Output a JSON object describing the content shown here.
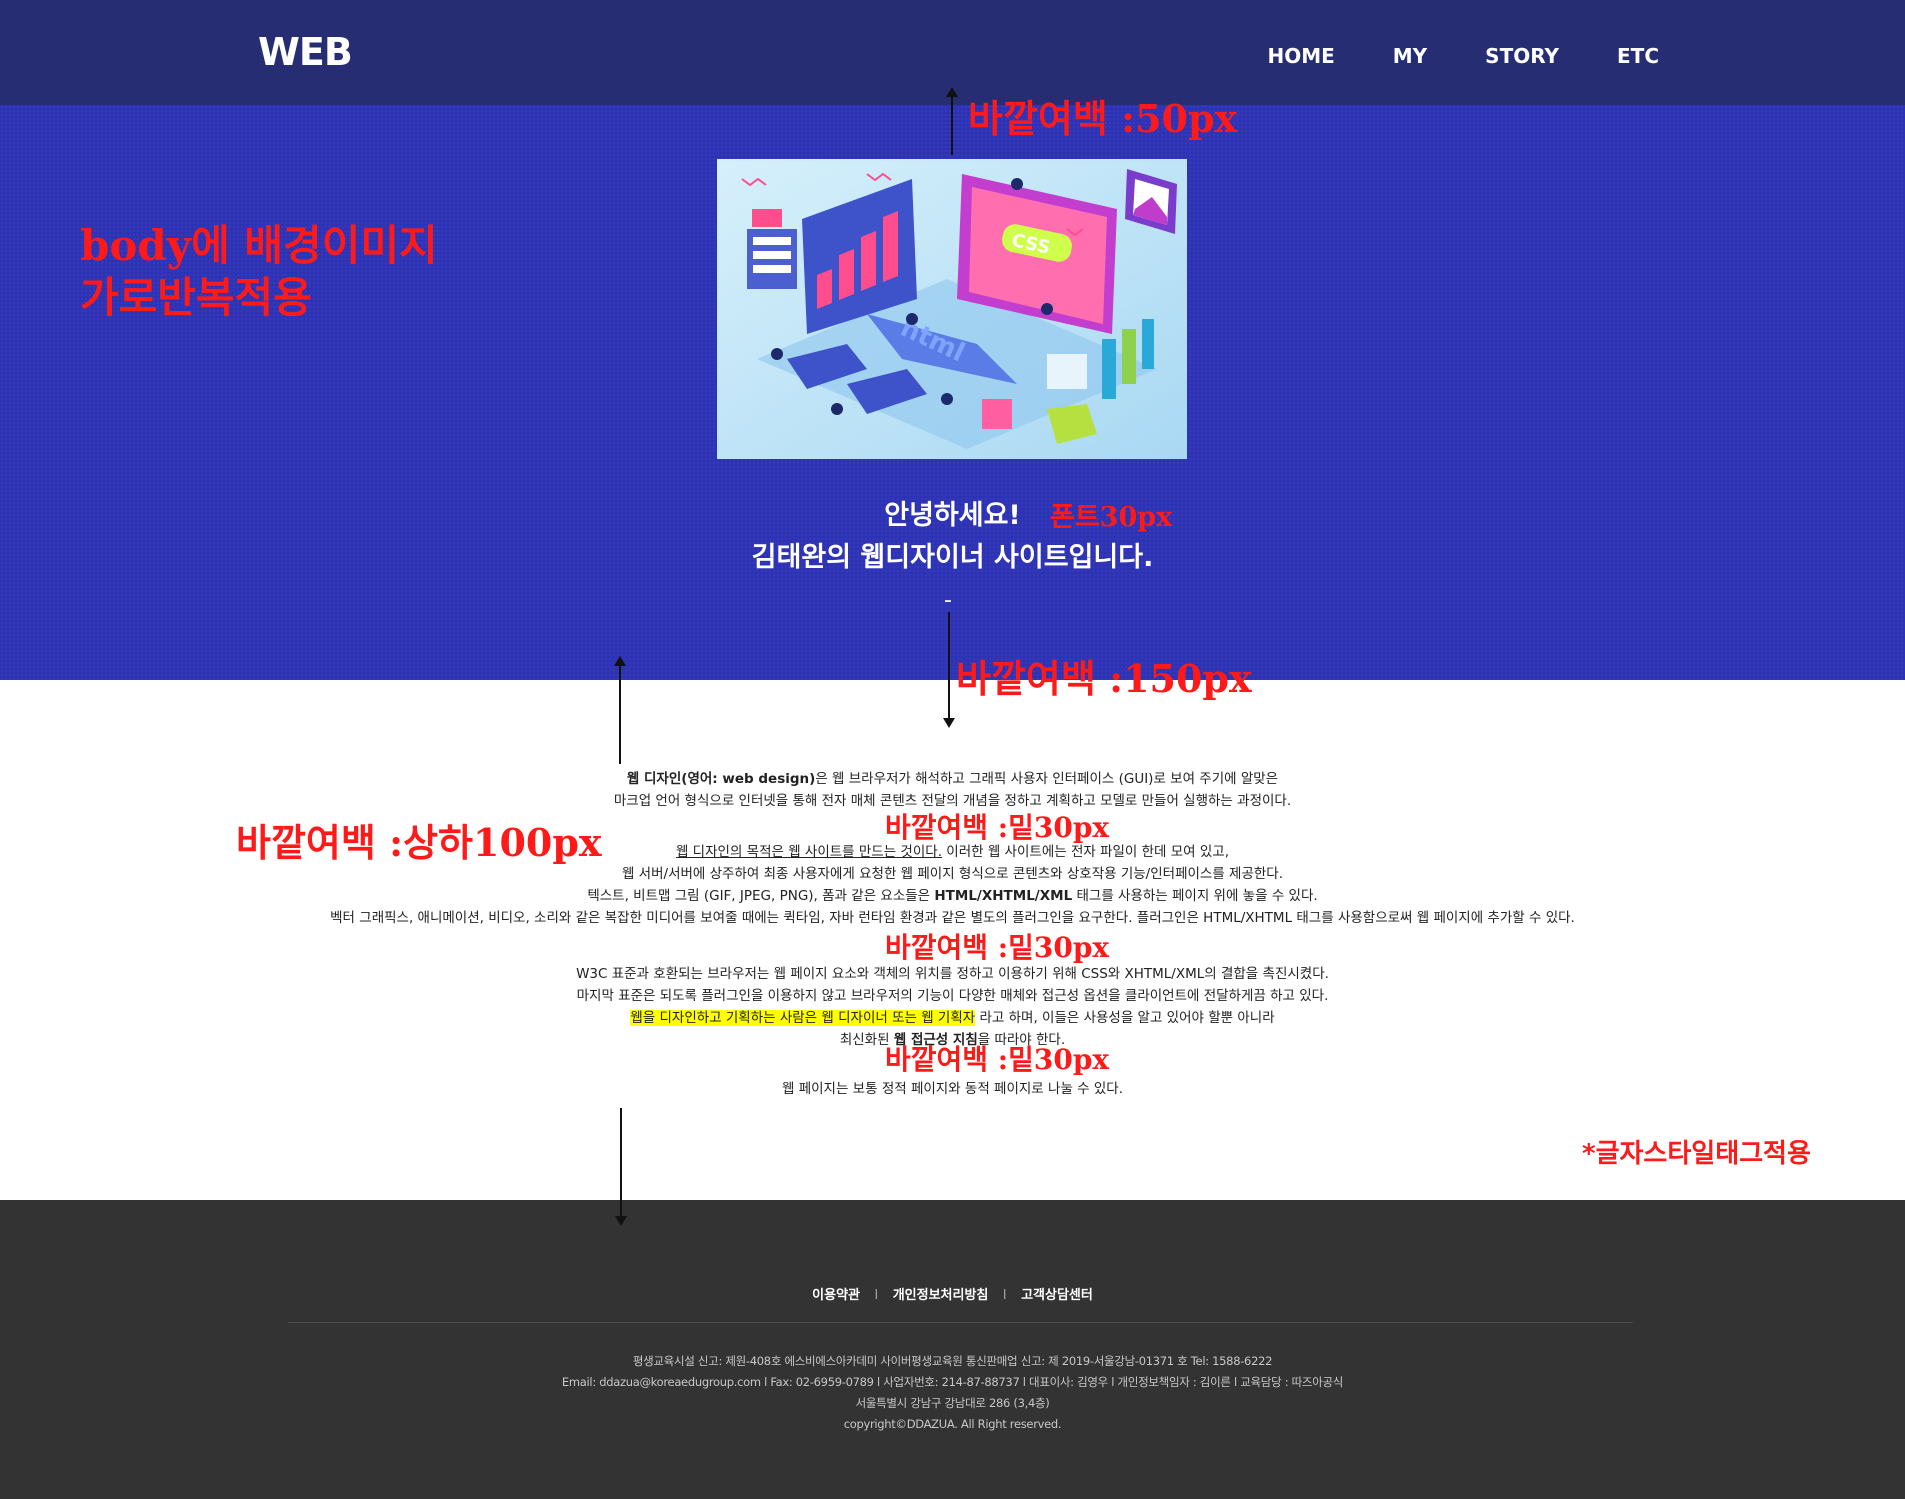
{
  "header": {
    "logo": "WEB",
    "nav": [
      "HOME",
      "MY",
      "STORY",
      "ETC"
    ]
  },
  "hero": {
    "greeting_line1": "안녕하세요!",
    "greeting_line2": "김태완의 웹디자이너 사이트입니다.",
    "dash": "-",
    "image_words": {
      "css": "CSS",
      "html": "html"
    }
  },
  "content": {
    "p1_bold": "웹 디자인(영어: web design)",
    "p1_rest": "은 웹 브라우저가 해석하고 그래픽 사용자 인터페이스 (GUI)로 보여 주기에 알맞은",
    "p1_line2": "마크업 언어 형식으로 인터넷을 통해 전자 매체 콘텐츠 전달의 개념을 정하고 계획하고 모델로 만들어 실행하는 과정이다.",
    "p2_underline": "웹 디자인의 목적은 웹 사이트를 만드는 것이다.",
    "p2_rest": " 이러한 웹 사이트에는 전자 파일이 한데 모여 있고,",
    "p2_line2": "웹 서버/서버에 상주하여 최종 사용자에게 요청한 웹 페이지 형식으로 콘텐츠와 상호작용 기능/인터페이스를 제공한다.",
    "p2_line3_a": "텍스트, 비트맵 그림 (GIF, JPEG, PNG), 폼과 같은 요소들은 ",
    "p2_line3_b": "HTML/XHTML/XML",
    "p2_line3_c": " 태그를 사용하는 페이지 위에 놓을 수 있다.",
    "p2_line4": "벡터 그래픽스, 애니메이션, 비디오, 소리와 같은 복잡한 미디어를 보여줄 때에는 퀵타임, 자바 런타임 환경과 같은 별도의 플러그인을 요구한다. 플러그인은 HTML/XHTML 태그를 사용함으로써 웹 페이지에 추가할 수 있다.",
    "p3_line1": "W3C 표준과 호환되는 브라우저는 웹 페이지 요소와 객체의 위치를 정하고 이용하기 위해 CSS와 XHTML/XML의 결합을 촉진시켰다.",
    "p3_line2": "마지막 표준은 되도록 플러그인을 이용하지 않고 브라우저의 기능이 다양한 매체와 접근성 옵션을 클라이언트에 전달하게끔 하고 있다.",
    "p3_line3_hl": "웹을 디자인하고 기획하는 사람은 웹 디자이너 또는 웹 기획자",
    "p3_line3_rest": " 라고 하며, 이들은 사용성을 알고 있어야 할뿐 아니라",
    "p3_line4_a": "최신화된 ",
    "p3_line4_b": "웹 접근성 지침",
    "p3_line4_c": "을 따라야 한다.",
    "p4": "웹 페이지는 보통 정적 페이지와 동적 페이지로 나눌 수 있다."
  },
  "footer": {
    "links": [
      "이용약관",
      "개인정보처리방침",
      "고객상담센터"
    ],
    "separator": "l",
    "info": [
      "평생교육시설 신고: 제원-408호 에스비에스아카데미 사이버평생교육원 통신판매업 신고: 제 2019-서울강남-01371 호 Tel: 1588-6222",
      "Email: ddazua@koreaedugroup.com l Fax: 02-6959-0789 l 사업자번호: 214-87-88737 l 대표이사: 김영우 l 개인정보책임자 : 김이른 l 교육담당 : 따즈아공식",
      "서울특별시 강남구 강남대로 286 (3,4층)",
      "copyright©DDAZUA. All Right reserved."
    ]
  },
  "annotations": {
    "body_bg_line1": "body에 배경이미지",
    "body_bg_line2": "가로반복적용",
    "margin_50": "바깥여백 :50px",
    "font_30": "폰트30px",
    "margin_150": "바깥여백 :150px",
    "margin_tb100": "바깥여백 :상하100px",
    "margin_b30_a": "바깥여백 :밑30px",
    "margin_b30_b": "바깥여백 :밑30px",
    "margin_b30_c": "바깥여백 :밑30px",
    "text_style": "*글자스타일태그적용"
  },
  "colors": {
    "header_bg": "#262d72",
    "hero_bg": "#2d33b4",
    "footer_bg": "#333333",
    "annotation": "#ff1a1a",
    "highlight": "#ffff00"
  }
}
